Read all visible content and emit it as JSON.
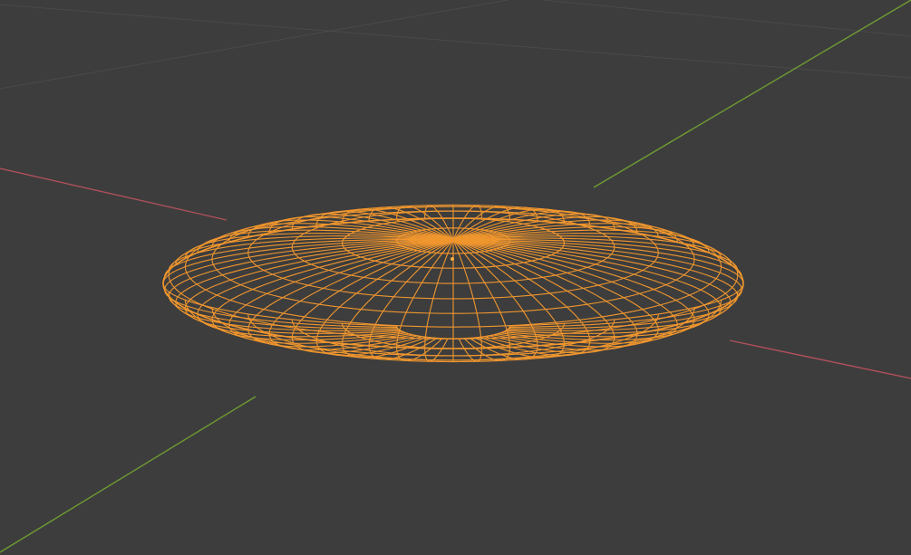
{
  "viewport": {
    "background_color": "#3d3d3d",
    "grid_color": "#4a4a4a",
    "x_axis_color": "#b0505c",
    "y_axis_color": "#6e9a32",
    "selection_color": "#f0962e",
    "origin_color": "#ffae40"
  },
  "object": {
    "type": "uv-sphere",
    "scale": "flattened",
    "selected": true,
    "display": "wireframe",
    "segments": 64,
    "rings": 16
  }
}
